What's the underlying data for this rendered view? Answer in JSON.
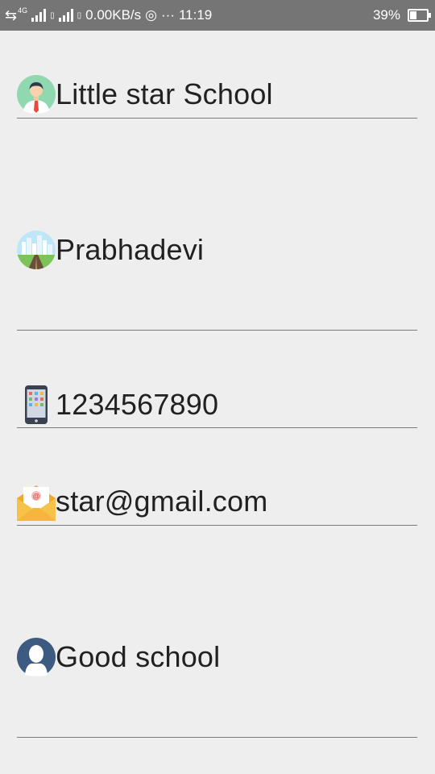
{
  "status_bar": {
    "net_speed": "0.00KB/s",
    "time": "11:19",
    "battery": "39%",
    "network_type": "4G",
    "battery_level": 0.39
  },
  "form": {
    "school_name": "Little star School",
    "address": "Prabhadevi",
    "phone": "1234567890",
    "email": "star@gmail.com",
    "description": "Good school"
  },
  "icons": {
    "school_name": "person-icon",
    "address": "city-road-icon",
    "phone": "smartphone-icon",
    "email": "mail-icon",
    "description": "user-silhouette-icon"
  }
}
